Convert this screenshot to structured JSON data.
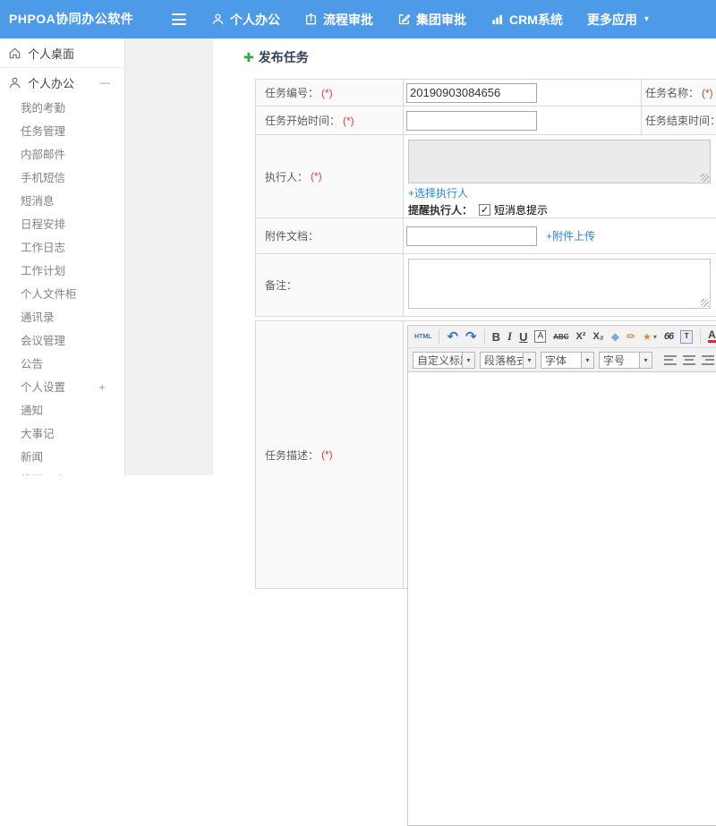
{
  "colors": {
    "topbar": "#4d9ae8",
    "link": "#2e82d9",
    "required": "#e23b3b",
    "accent_green": "#3aa63a"
  },
  "topbar": {
    "logo": "PHPOA协同办公软件",
    "nav": [
      {
        "label": "个人办公"
      },
      {
        "label": "流程审批"
      },
      {
        "label": "集团审批"
      },
      {
        "label": "CRM系统"
      },
      {
        "label": "更多应用"
      }
    ],
    "more_caret": "▾"
  },
  "sidebar": {
    "desktop": {
      "label": "个人桌面"
    },
    "office": {
      "label": "个人办公",
      "toggle": "—"
    },
    "settings_toggle": "+",
    "subitems": [
      "我的考勤",
      "任务管理",
      "内部邮件",
      "手机短信",
      "短消息",
      "日程安排",
      "工作日志",
      "工作计划",
      "个人文件柜",
      "通讯录",
      "会议管理",
      "公告",
      "个人设置",
      "通知",
      "大事记",
      "新闻",
      "投票调查"
    ]
  },
  "page": {
    "title": "发布任务",
    "icon_glyph": "✚"
  },
  "form": {
    "required_mark": "(*)",
    "task_no_label": "任务编号：",
    "task_no_value": "20190903084656",
    "task_name_label": "任务名称：",
    "start_label": "任务开始时间：",
    "end_label": "任务结束时间：",
    "executor_label": "执行人：",
    "choose_executor_link": "+选择执行人",
    "remind_label": "提醒执行人：",
    "checkbox_glyph": "✓",
    "sms_checkbox_label": "短消息提示",
    "attachment_label": "附件文档：",
    "upload_link": "+附件上传",
    "remark_label": "备注：",
    "desc_label": "任务描述："
  },
  "editor": {
    "buttons": {
      "html": "HTML",
      "undo": "↶",
      "redo": "↷",
      "bold": "B",
      "italic": "I",
      "underline": "U",
      "fontbox": "A",
      "strike": "ABC",
      "sup": "X²",
      "sub": "X₂",
      "eraser": "◆",
      "brush": "✏",
      "wand": "★",
      "quote": "66",
      "paste": "T",
      "forecolor": "A",
      "caret": "▾"
    },
    "selects": [
      "自定义标题",
      "段落格式",
      "字体",
      "字号"
    ]
  }
}
